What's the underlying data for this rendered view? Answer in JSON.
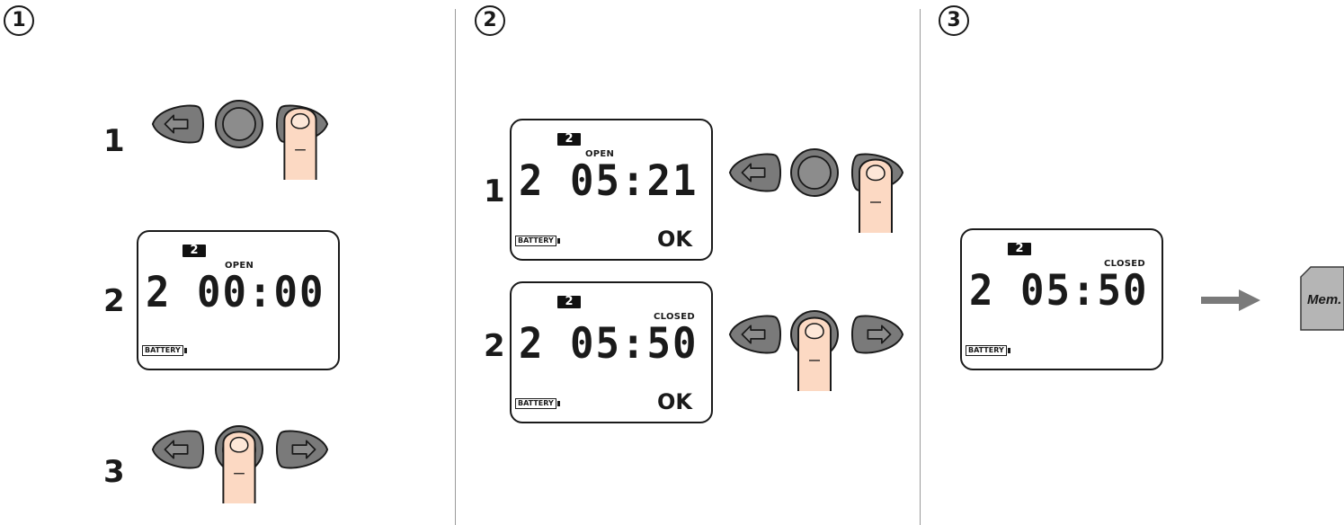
{
  "sections": [
    {
      "badge": "1",
      "steps": [
        "1",
        "2",
        "3"
      ],
      "lcd": {
        "channel": "2",
        "state": "OPEN",
        "digits": "2 00:00",
        "battery": "BATTERY"
      }
    },
    {
      "badge": "2",
      "steps": [
        "1",
        "2"
      ],
      "lcd_a": {
        "channel": "2",
        "state": "OPEN",
        "digits": "2 05:21",
        "battery": "BATTERY",
        "ok": "OK"
      },
      "lcd_b": {
        "channel": "2",
        "state": "CLOSED",
        "digits": "2 05:50",
        "battery": "BATTERY",
        "ok": "OK"
      }
    },
    {
      "badge": "3",
      "lcd": {
        "channel": "2",
        "state": "CLOSED",
        "digits": "2 05:50",
        "battery": "BATTERY"
      },
      "memory_label": "Mem."
    }
  ],
  "icons": {
    "left": "left-arrow-button-icon",
    "center": "center-button-icon",
    "right": "right-arrow-button-icon",
    "finger": "finger-press-icon",
    "arrow": "right-arrow-icon",
    "memory": "memory-card-icon"
  }
}
